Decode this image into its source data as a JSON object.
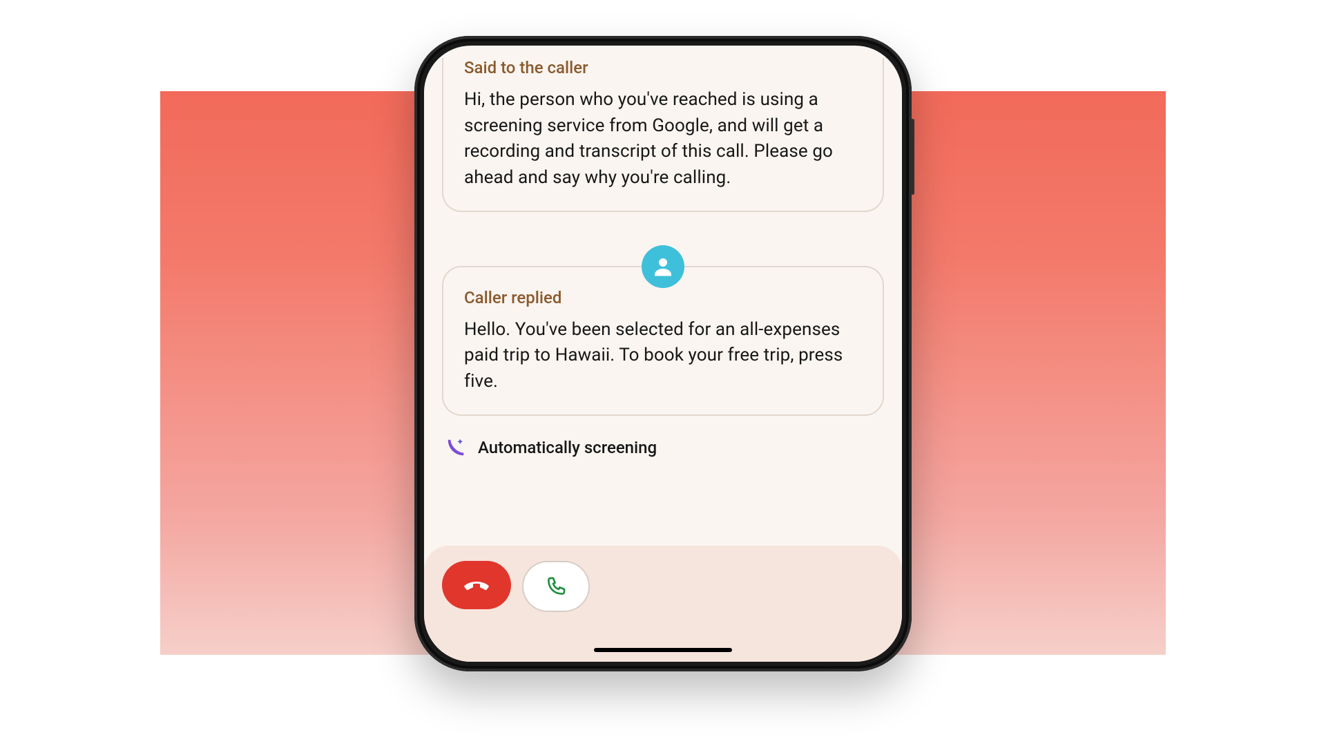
{
  "transcript": {
    "said_to_caller": {
      "label": "Said to the caller",
      "body": "Hi, the person who you've reached is using a screening service from Google, and will get a recording and transcript of this call. Please go ahead and say why you're calling."
    },
    "caller_replied": {
      "label": "Caller replied",
      "body": "Hello. You've been selected for an all-expenses paid trip to Hawaii. To book your free trip, press five."
    }
  },
  "status": {
    "text": "Automatically screening"
  },
  "colors": {
    "hangup": "#e1362c",
    "answer_outline": "#d6cec7",
    "label": "#8a5a2d",
    "avatar": "#3fc0da"
  }
}
